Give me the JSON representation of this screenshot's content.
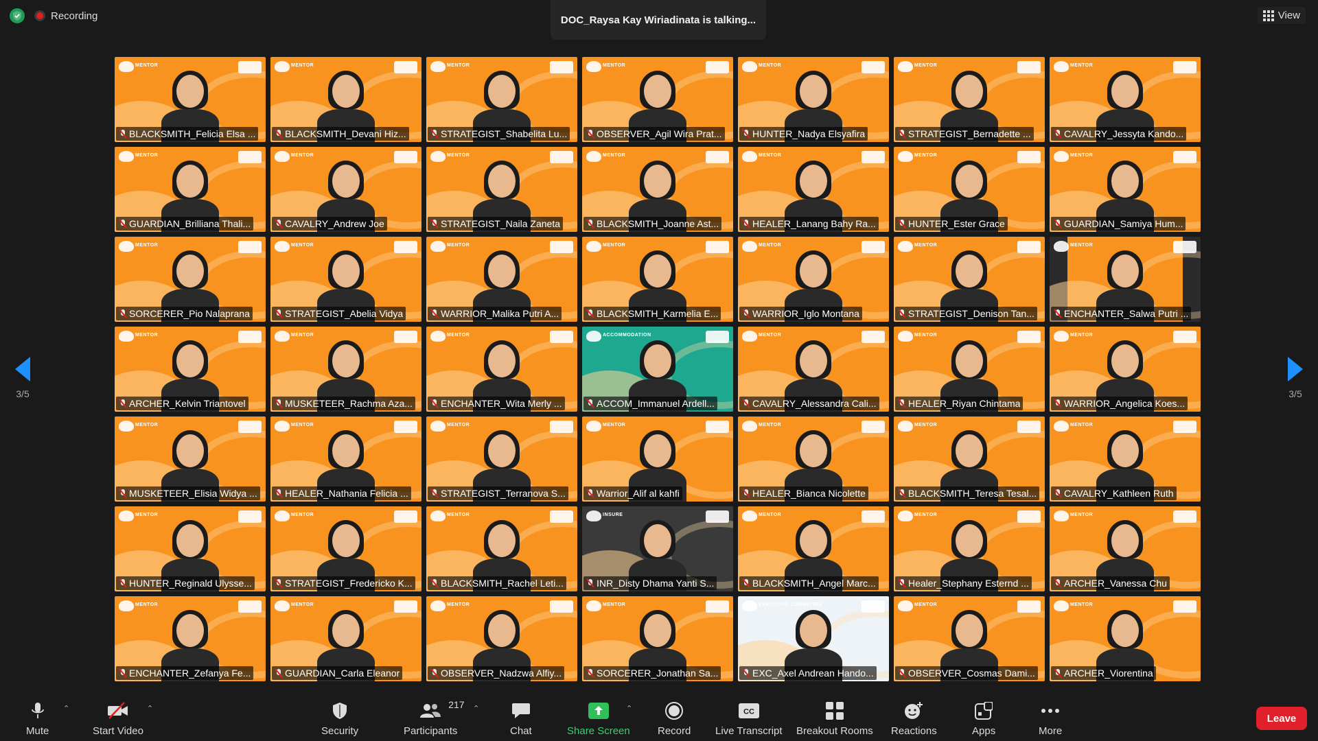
{
  "top": {
    "recording_label": "Recording",
    "talking_text": "DOC_Raysa Kay Wiriadinata is talking...",
    "view_label": "View"
  },
  "pager": {
    "left_label": "3/5",
    "right_label": "3/5"
  },
  "tiles": [
    {
      "name": "BLACKSMITH_Felicia Elsa ...",
      "bg": "orange"
    },
    {
      "name": "BLACKSMITH_Devani Hiz...",
      "bg": "orange"
    },
    {
      "name": "STRATEGIST_Shabelita Lu...",
      "bg": "orange"
    },
    {
      "name": "OBSERVER_Agil Wira Prat...",
      "bg": "orange"
    },
    {
      "name": "HUNTER_Nadya Elsyafira",
      "bg": "orange"
    },
    {
      "name": "STRATEGIST_Bernadette ...",
      "bg": "orange"
    },
    {
      "name": "CAVALRY_Jessyta Kando...",
      "bg": "orange"
    },
    {
      "name": "GUARDIAN_Brilliana Thali...",
      "bg": "orange"
    },
    {
      "name": "CAVALRY_Andrew Joe",
      "bg": "orange"
    },
    {
      "name": "STRATEGIST_Naila Zaneta",
      "bg": "orange"
    },
    {
      "name": "BLACKSMITH_Joanne Ast...",
      "bg": "orange"
    },
    {
      "name": "HEALER_Lanang Bahy Ra...",
      "bg": "orange"
    },
    {
      "name": "HUNTER_Ester Grace",
      "bg": "orange"
    },
    {
      "name": "GUARDIAN_Samiya Hum...",
      "bg": "orange"
    },
    {
      "name": "SORCERER_Pio Nalaprana",
      "bg": "orange"
    },
    {
      "name": "STRATEGIST_Abelia Vidya",
      "bg": "orange"
    },
    {
      "name": "WARRIOR_Malika Putri A...",
      "bg": "orange"
    },
    {
      "name": "BLACKSMITH_Karmelia E...",
      "bg": "orange"
    },
    {
      "name": "WARRIOR_Iglo Montana",
      "bg": "orange"
    },
    {
      "name": "STRATEGIST_Denison Tan...",
      "bg": "orange"
    },
    {
      "name": "ENCHANTER_Salwa Putri ...",
      "bg": "dark"
    },
    {
      "name": "ARCHER_Kelvin Triantovel",
      "bg": "orange"
    },
    {
      "name": "MUSKETEER_Rachma Aza...",
      "bg": "orange"
    },
    {
      "name": "ENCHANTER_Wita Merly ...",
      "bg": "orange"
    },
    {
      "name": "ACCOM_Immanuel Ardell...",
      "bg": "teal",
      "logo_text": "ACCOMMODATION"
    },
    {
      "name": "CAVALRY_Alessandra Cali...",
      "bg": "orange"
    },
    {
      "name": "HEALER_Riyan Chintama",
      "bg": "orange"
    },
    {
      "name": "WARRIOR_Angelica Koes...",
      "bg": "orange"
    },
    {
      "name": "MUSKETEER_Elisia Widya ...",
      "bg": "orange"
    },
    {
      "name": "HEALER_Nathania Felicia ...",
      "bg": "orange"
    },
    {
      "name": "STRATEGIST_Terranova S...",
      "bg": "orange"
    },
    {
      "name": "Warrior_Alif al kahfi",
      "bg": "orange"
    },
    {
      "name": "HEALER_Bianca Nicolette",
      "bg": "orange"
    },
    {
      "name": "BLACKSMITH_Teresa Tesal...",
      "bg": "orange"
    },
    {
      "name": "CAVALRY_Kathleen Ruth",
      "bg": "orange"
    },
    {
      "name": "HUNTER_Reginald Ulysse...",
      "bg": "orange"
    },
    {
      "name": "STRATEGIST_Fredericko K...",
      "bg": "orange"
    },
    {
      "name": "BLACKSMITH_Rachel Leti...",
      "bg": "orange"
    },
    {
      "name": "INR_Disty Dhama Yanti S...",
      "bg": "gray",
      "logo_text": "INSURE"
    },
    {
      "name": "BLACKSMITH_Angel Marc...",
      "bg": "orange"
    },
    {
      "name": "Healer_Stephany Esternd ...",
      "bg": "orange"
    },
    {
      "name": "ARCHER_Vanessa Chu",
      "bg": "orange"
    },
    {
      "name": "ENCHANTER_Zefanya Fe...",
      "bg": "orange"
    },
    {
      "name": "GUARDIAN_Carla Eleanor",
      "bg": "orange"
    },
    {
      "name": "OBSERVER_Nadzwa Alfiy...",
      "bg": "orange"
    },
    {
      "name": "SORCERER_Jonathan Sa...",
      "bg": "orange"
    },
    {
      "name": "EXC_Axel Andrean Hando...",
      "bg": "white",
      "logo_text": "EXECUTIVE COMMITTEE"
    },
    {
      "name": "OBSERVER_Cosmas Dami...",
      "bg": "orange"
    },
    {
      "name": "ARCHER_Viorentina",
      "bg": "orange"
    }
  ],
  "default_logo_text": "MENTOR",
  "toolbar": {
    "mute": "Mute",
    "start_video": "Start Video",
    "security": "Security",
    "participants": "Participants",
    "participants_count": "217",
    "chat": "Chat",
    "share_screen": "Share Screen",
    "record": "Record",
    "live_transcript": "Live Transcript",
    "breakout_rooms": "Breakout Rooms",
    "reactions": "Reactions",
    "apps": "Apps",
    "more": "More",
    "leave": "Leave"
  },
  "colors": {
    "accent_blue": "#1e90ff",
    "share_green": "#3cd070",
    "leave_red": "#e0202a",
    "tile_orange": "#f7931e"
  }
}
